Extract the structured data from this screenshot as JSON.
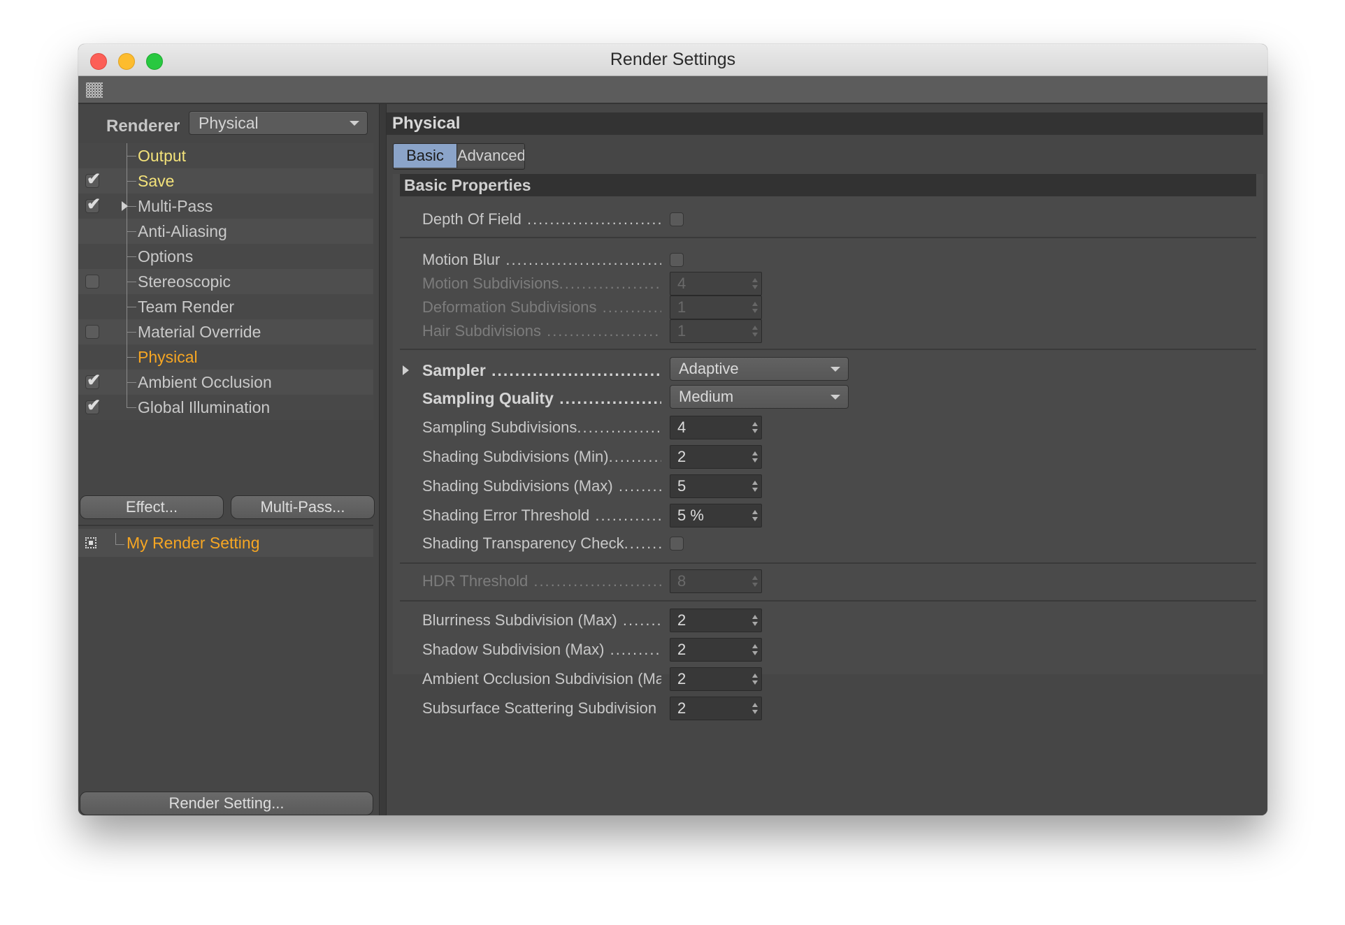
{
  "window": {
    "title": "Render Settings"
  },
  "left": {
    "renderer_label": "Renderer",
    "renderer_value": "Physical",
    "tree": [
      {
        "label": "Output",
        "check": "none",
        "color": "yellow",
        "expander": false
      },
      {
        "label": "Save",
        "check": "checked",
        "color": "yellow",
        "expander": false
      },
      {
        "label": "Multi-Pass",
        "check": "checked",
        "color": "normal",
        "expander": true
      },
      {
        "label": "Anti-Aliasing",
        "check": "none",
        "color": "normal",
        "expander": false
      },
      {
        "label": "Options",
        "check": "none",
        "color": "normal",
        "expander": false
      },
      {
        "label": "Stereoscopic",
        "check": "unchecked",
        "color": "normal",
        "expander": false
      },
      {
        "label": "Team Render",
        "check": "none",
        "color": "normal",
        "expander": false
      },
      {
        "label": "Material Override",
        "check": "unchecked",
        "color": "normal",
        "expander": false
      },
      {
        "label": "Physical",
        "check": "none",
        "color": "orange",
        "expander": false
      },
      {
        "label": "Ambient Occlusion",
        "check": "checked",
        "color": "normal",
        "expander": false
      },
      {
        "label": "Global Illumination",
        "check": "checked",
        "color": "normal",
        "expander": false
      }
    ],
    "effect_button": "Effect...",
    "multipass_button": "Multi-Pass...",
    "setting_name": "My Render Setting",
    "render_setting_button": "Render Setting..."
  },
  "right": {
    "header": "Physical",
    "tabs": {
      "basic": "Basic",
      "advanced": "Advanced"
    },
    "section": "Basic Properties",
    "depth_of_field": "Depth Of Field",
    "motion_blur": "Motion Blur",
    "motion_subdivisions": {
      "label": "Motion Subdivisions",
      "value": "4"
    },
    "deformation_subdivisions": {
      "label": "Deformation Subdivisions",
      "value": "1"
    },
    "hair_subdivisions": {
      "label": "Hair Subdivisions",
      "value": "1"
    },
    "sampler": {
      "label": "Sampler",
      "value": "Adaptive"
    },
    "sampling_quality": {
      "label": "Sampling Quality",
      "value": "Medium"
    },
    "sampling_subdivisions": {
      "label": "Sampling Subdivisions",
      "value": "4"
    },
    "shading_sub_min": {
      "label": "Shading Subdivisions (Min)",
      "value": "2"
    },
    "shading_sub_max": {
      "label": "Shading Subdivisions (Max)",
      "value": "5"
    },
    "shading_error": {
      "label": "Shading Error Threshold",
      "value": "5 %"
    },
    "shading_transparency": "Shading Transparency Check",
    "hdr_threshold": {
      "label": "HDR Threshold",
      "value": "8"
    },
    "blurriness": {
      "label": "Blurriness Subdivision (Max)",
      "value": "2"
    },
    "shadow": {
      "label": "Shadow Subdivision (Max)",
      "value": "2"
    },
    "ao_sub": {
      "label": "Ambient Occlusion Subdivision (Max)",
      "value": "2"
    },
    "sss_sub": {
      "label": "Subsurface Scattering Subdivision (Max)",
      "value": "2"
    }
  }
}
